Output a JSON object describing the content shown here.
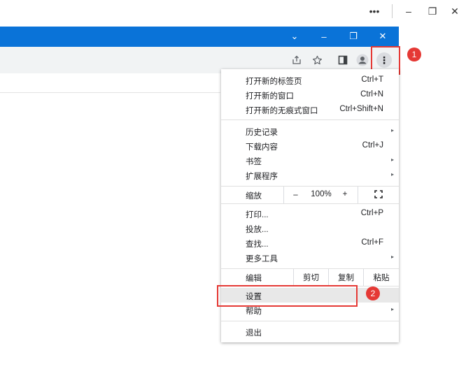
{
  "outer_window": {
    "more_glyph": "•••",
    "minimize_glyph": "–",
    "restore_glyph": "❐",
    "close_glyph": "✕"
  },
  "titlebar": {
    "color": "#0a73d8",
    "dropdown_glyph": "⌄",
    "minimize_glyph": "–",
    "restore_glyph": "❐",
    "close_glyph": "✕"
  },
  "toolbar": {
    "share_icon": "share-icon",
    "star_icon": "star-icon",
    "sidepanel_icon": "side-panel-icon",
    "profile_icon": "profile-icon",
    "menu_glyph": "⋮"
  },
  "annotations": {
    "badge_1": "1",
    "badge_2": "2",
    "color": "#e53935"
  },
  "menu": {
    "group1": [
      {
        "label": "打开新的标签页",
        "shortcut": "Ctrl+T"
      },
      {
        "label": "打开新的窗口",
        "shortcut": "Ctrl+N"
      },
      {
        "label": "打开新的无痕式窗口",
        "shortcut": "Ctrl+Shift+N"
      }
    ],
    "group2": [
      {
        "label": "历史记录",
        "shortcut": "",
        "submenu": "▸"
      },
      {
        "label": "下载内容",
        "shortcut": "Ctrl+J",
        "submenu": ""
      },
      {
        "label": "书签",
        "shortcut": "",
        "submenu": "▸"
      },
      {
        "label": "扩展程序",
        "shortcut": "",
        "submenu": "▸"
      }
    ],
    "zoom": {
      "label": "缩放",
      "minus": "–",
      "value": "100%",
      "plus": "+",
      "fullscreen_icon": "fullscreen-icon"
    },
    "group3": [
      {
        "label": "打印...",
        "shortcut": "Ctrl+P",
        "submenu": ""
      },
      {
        "label": "投放...",
        "shortcut": "",
        "submenu": ""
      },
      {
        "label": "查找...",
        "shortcut": "Ctrl+F",
        "submenu": ""
      },
      {
        "label": "更多工具",
        "shortcut": "",
        "submenu": "▸"
      }
    ],
    "edit": {
      "label": "编辑",
      "cut": "剪切",
      "copy": "复制",
      "paste": "粘贴"
    },
    "group4": [
      {
        "label": "设置",
        "submenu": ""
      },
      {
        "label": "帮助",
        "submenu": "▸"
      }
    ],
    "exit": {
      "label": "退出"
    }
  }
}
